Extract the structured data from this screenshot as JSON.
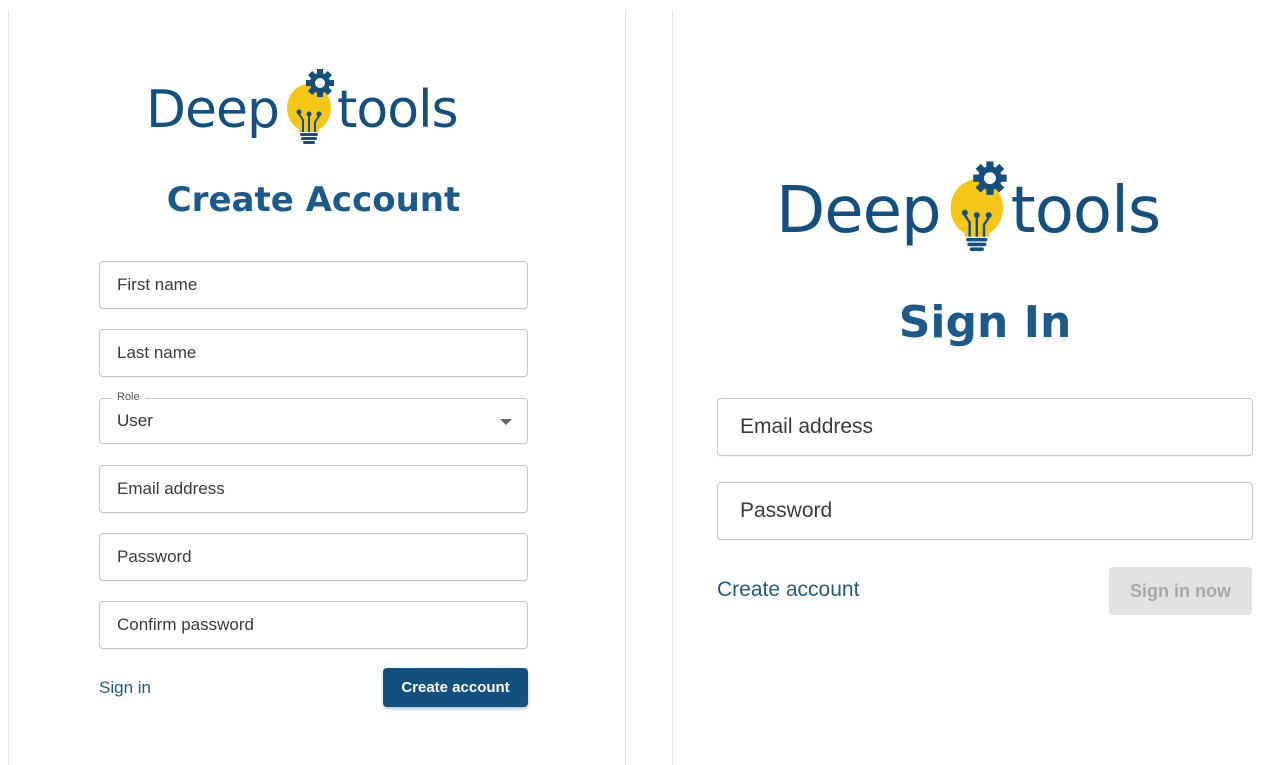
{
  "brand": {
    "word1": "Deep",
    "word2": "tools",
    "color": "#14507f",
    "bulb_color": "#f5c518"
  },
  "create_account_panel": {
    "title": "Create Account",
    "first_name": {
      "placeholder": "First name",
      "value": ""
    },
    "last_name": {
      "placeholder": "Last name",
      "value": ""
    },
    "role": {
      "label": "Role",
      "value": "User"
    },
    "email": {
      "placeholder": "Email address",
      "value": ""
    },
    "password": {
      "placeholder": "Password",
      "value": ""
    },
    "confirm_password": {
      "placeholder": "Confirm password",
      "value": ""
    },
    "sign_in_link": "Sign in",
    "submit_button": "Create account"
  },
  "sign_in_panel": {
    "title": "Sign In",
    "email": {
      "placeholder": "Email address",
      "value": ""
    },
    "password": {
      "placeholder": "Password",
      "value": ""
    },
    "create_account_link": "Create account",
    "submit_button": "Sign in now"
  },
  "colors": {
    "primary": "#14507f",
    "heading": "#1d5a8c",
    "disabled_bg": "#e2e2e2",
    "disabled_text": "#a7a7a7"
  }
}
